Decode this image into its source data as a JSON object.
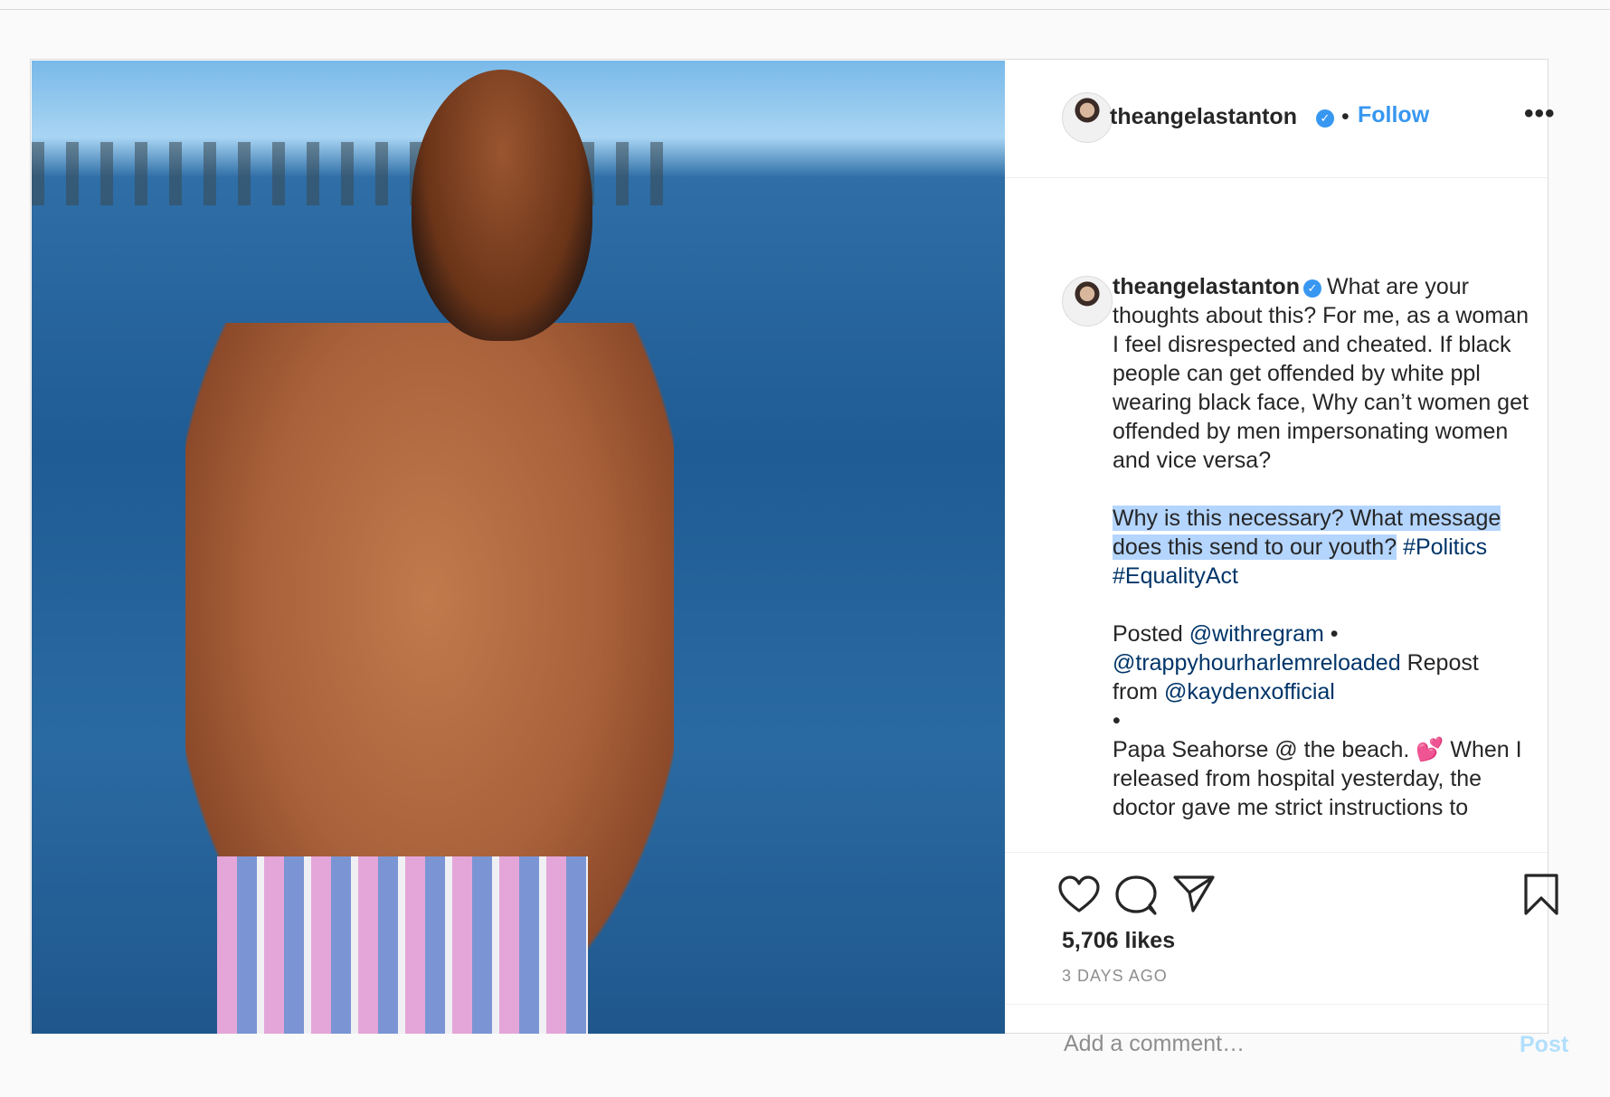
{
  "post": {
    "username": "theangelastanton",
    "verified_icon": "verified-badge-icon",
    "separator": "•",
    "follow_label": "Follow",
    "more_label": "•••",
    "caption": {
      "username": "theangelastanton",
      "p1": "What are your thoughts about this? For me, as a woman I feel disrespected and cheated. If black people can get offended by white ppl wearing black face, Why can’t women get offended by men impersonating women and vice versa?",
      "p2_highlight": "Why is this necessary? What message does this send to our youth?",
      "tag_politics": "#Politics",
      "tag_equality": "#EqualityAct",
      "posted": "Posted",
      "mention_withregram": "@withregram",
      "bullet": "•",
      "mention_trappy": "@trappyhourharlemreloaded",
      "repost_from": "Repost from",
      "mention_kayden": "@kaydenxofficial",
      "bullet2": "•",
      "p4": "Papa Seahorse @ the beach. 💕 When I released from hospital yesterday, the doctor gave me strict instructions to"
    },
    "likes": "5,706 likes",
    "time": "3 DAYS AGO",
    "comment_placeholder": "Add a comment…",
    "post_label": "Post"
  },
  "colors": {
    "accent": "#3897f0",
    "link": "#003569",
    "highlight": "#b4d5fe",
    "post_disabled": "#b2dffc"
  }
}
